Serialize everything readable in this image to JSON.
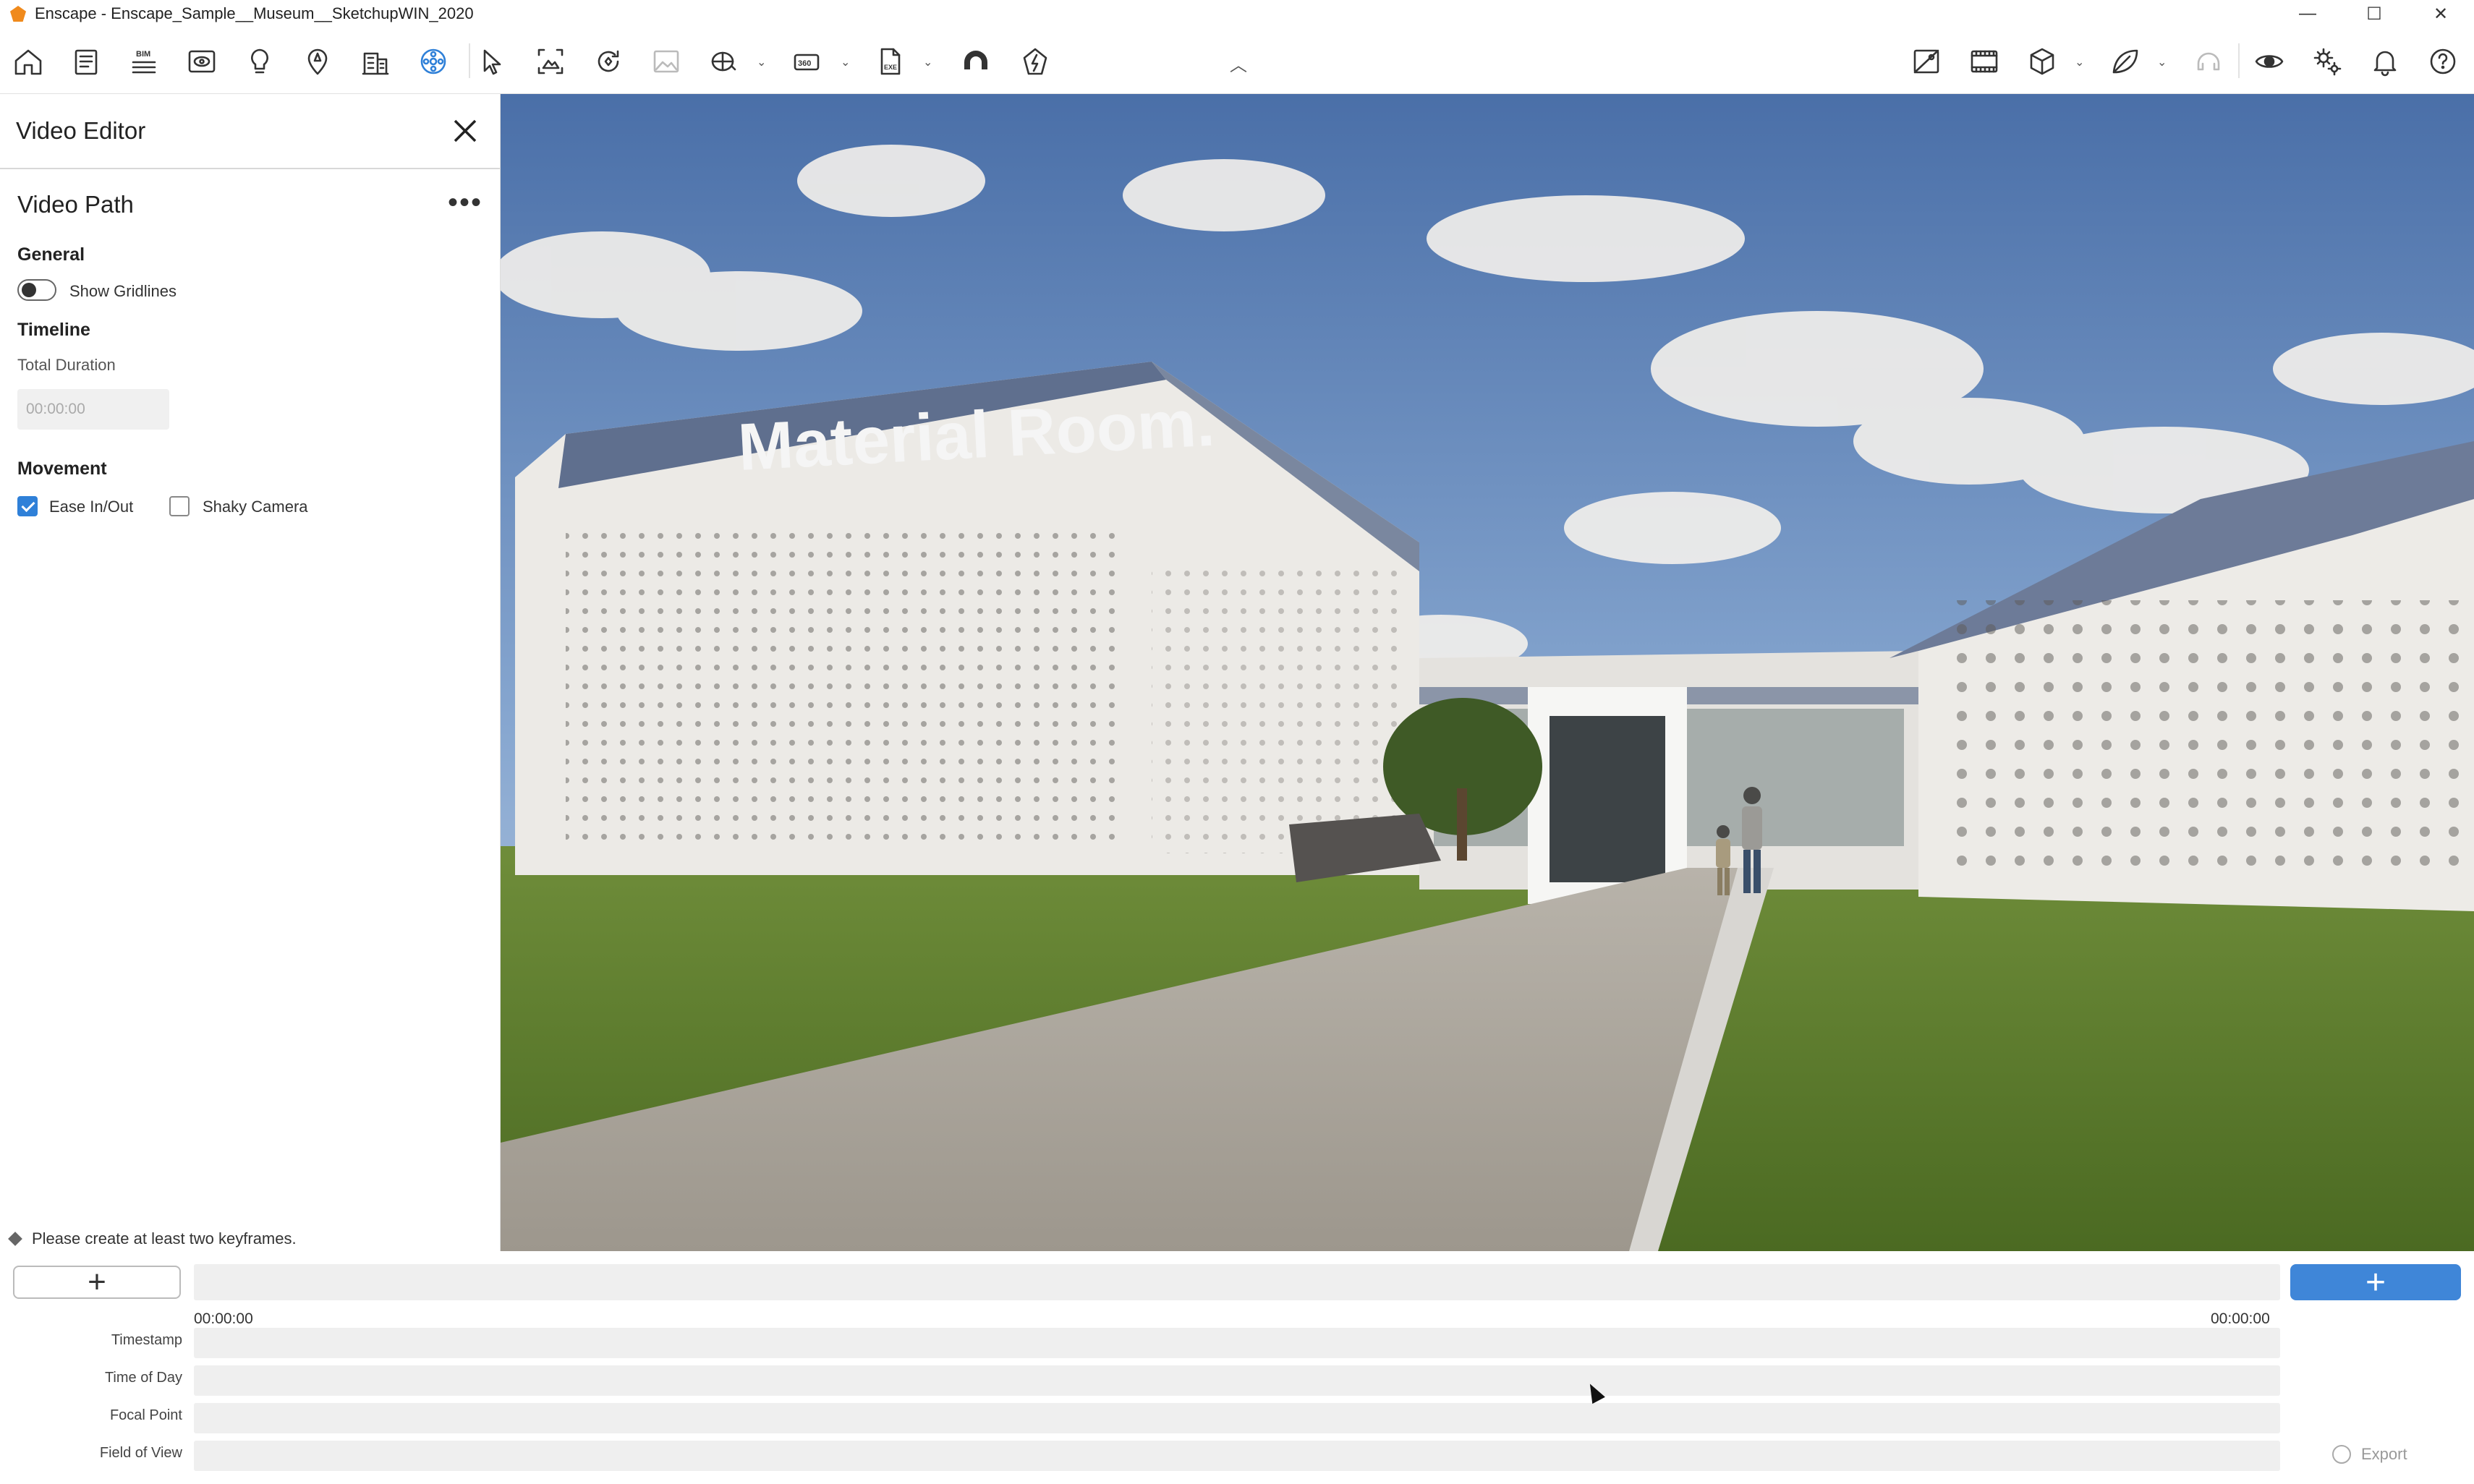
{
  "window": {
    "title": "Enscape - Enscape_Sample__Museum__SketchupWIN_2020",
    "controls": [
      "—",
      "☐",
      "✕"
    ]
  },
  "toolbar": {
    "left_icons": [
      "home-icon",
      "document-icon",
      "bim-icon",
      "views-icon",
      "lightbulb-icon",
      "map-marker-icon",
      "building-icon",
      "video-editor-icon",
      "select-cursor-icon",
      "screenshot-icon",
      "batch-render-icon",
      "image-icon",
      "panorama-icon",
      "panorama-360-icon",
      "export-exe-icon",
      "upload-cloud-icon",
      "enscape-live-icon"
    ],
    "bim_label": "BIM",
    "right_icons": [
      "no-image-icon",
      "film-strip-icon",
      "cube-icon",
      "leaf-icon",
      "headset-icon",
      "eye-icon",
      "settings-icon",
      "bell-icon",
      "help-icon"
    ],
    "accent_color": "#2f80d8"
  },
  "panel": {
    "title": "Video Editor",
    "section_title": "Video Path",
    "more_label": "•••",
    "general": {
      "heading": "General",
      "show_gridlines_label": "Show Gridlines",
      "show_gridlines": false
    },
    "timeline": {
      "heading": "Timeline",
      "total_duration_label": "Total Duration",
      "total_duration_placeholder": "00:00:00"
    },
    "movement": {
      "heading": "Movement",
      "ease_label": "Ease In/Out",
      "ease_checked": true,
      "shaky_label": "Shaky Camera",
      "shaky_checked": false
    },
    "status_message": "Please create at least two keyframes."
  },
  "viewport": {
    "sign_text": "Material Room."
  },
  "timeline_bar": {
    "add_label": "+",
    "add_keyframe_label": "+",
    "start_time": "00:00:00",
    "end_time": "00:00:00",
    "rows": [
      "Timestamp",
      "Time of Day",
      "Focal Point",
      "Field of View"
    ],
    "export_label": "Export"
  }
}
